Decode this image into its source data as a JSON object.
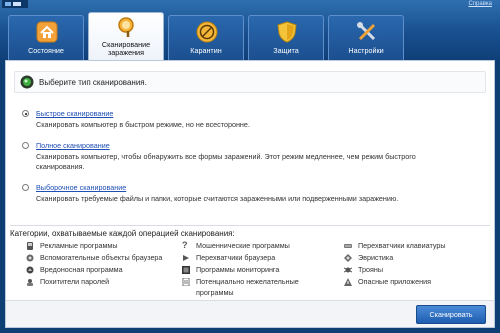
{
  "header": {
    "help_label": "Справка"
  },
  "tabs": [
    {
      "label": "Состояние",
      "icon": "house-icon",
      "active": false
    },
    {
      "label": "Сканирование\nзаражения",
      "icon": "magnifier-icon",
      "active": true
    },
    {
      "label": "Карантин",
      "icon": "quarantine-icon",
      "active": false
    },
    {
      "label": "Защита",
      "icon": "shield-icon",
      "active": false
    },
    {
      "label": "Настройки",
      "icon": "wrench-screwdriver-icon",
      "active": false
    }
  ],
  "scan": {
    "title": "Выберите тип сканирования.",
    "options": [
      {
        "link": "Быстрое сканирование",
        "desc": "Сканировать компьютер в быстром режиме, но не всесторонне.",
        "checked": true
      },
      {
        "link": "Полное сканирование",
        "desc": "Сканировать компьютер, чтобы обнаружить все формы заражений. Этот режим медленнее, чем режим быстрого сканирования.",
        "checked": false
      },
      {
        "link": "Выборочное сканирование",
        "desc": "Сканировать требуемые файлы и папки, которые считаются зараженными или подверженными заражению.",
        "checked": false
      }
    ]
  },
  "categories": {
    "header": "Категории, охватываемые каждой операцией сканирования:",
    "col1": [
      {
        "label": "Рекламные программы",
        "icon": "adware-icon"
      },
      {
        "label": "Вспомогательные объекты браузера",
        "icon": "browser-object-icon"
      },
      {
        "label": "Вредоносная программа",
        "icon": "malware-icon"
      },
      {
        "label": "Похитители паролей",
        "icon": "password-thief-icon"
      }
    ],
    "col2": [
      {
        "label": "Мошеннические программы",
        "icon": "question-icon"
      },
      {
        "label": "Перехватчики браузера",
        "icon": "hijacker-icon"
      },
      {
        "label": "Программы мониторинга",
        "icon": "monitor-icon"
      },
      {
        "label": "Потенциально нежелательные программы",
        "icon": "document-icon"
      }
    ],
    "col3": [
      {
        "label": "Перехватчики клавиатуры",
        "icon": "keylogger-icon"
      },
      {
        "label": "Эвристика",
        "icon": "heuristics-icon"
      },
      {
        "label": "Трояны",
        "icon": "trojan-icon"
      },
      {
        "label": "Опасные приложения",
        "icon": "warning-icon"
      }
    ]
  },
  "footer": {
    "scan_button": "Сканировать"
  },
  "colors": {
    "header_blue": "#184f8f",
    "link_blue": "#1f4fb5",
    "button_blue": "#1e5db0"
  }
}
